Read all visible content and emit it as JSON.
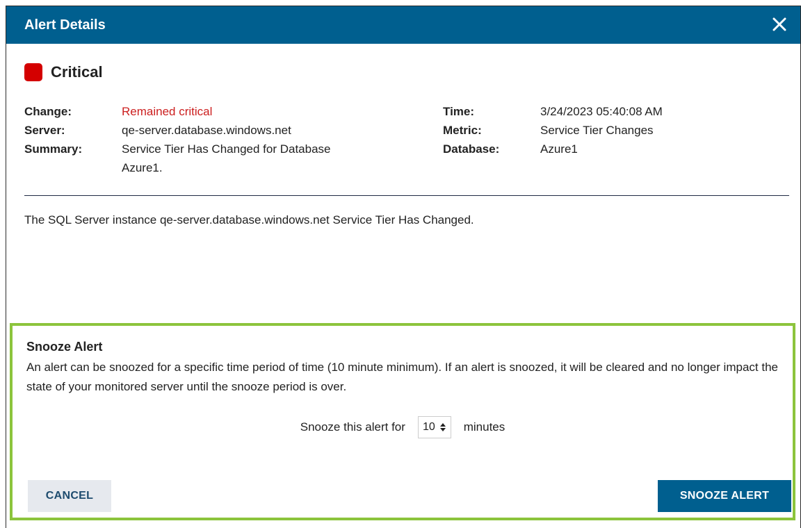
{
  "dialog": {
    "title": "Alert Details",
    "close_icon": "close-icon"
  },
  "severity": {
    "label": "Critical",
    "color": "#d40000"
  },
  "details": {
    "left": [
      {
        "key": "Change:",
        "value": "Remained critical"
      },
      {
        "key": "Server:",
        "value": "qe-server.database.windows.net"
      },
      {
        "key": "Summary:",
        "value": "Service Tier Has Changed for Database",
        "value2": "Azure1."
      }
    ],
    "right": [
      {
        "key": "Time:",
        "value": "3/24/2023 05:40:08 AM"
      },
      {
        "key": "Metric:",
        "value": "Service Tier Changes"
      },
      {
        "key": "Database:",
        "value": "Azure1"
      }
    ]
  },
  "message": "The SQL Server instance qe-server.database.windows.net Service Tier Has Changed.",
  "snooze": {
    "heading": "Snooze Alert",
    "description": "An alert can be snoozed for a specific time period of time (10 minute minimum). If an alert is snoozed, it will be cleared and no longer impact the state of your monitored server until the snooze period is over.",
    "prefix": "Snooze this alert for",
    "value": "10",
    "suffix": "minutes",
    "cancel_label": "CANCEL",
    "confirm_label": "SNOOZE ALERT"
  },
  "colors": {
    "header": "#005f8f",
    "highlight": "#8cc43c",
    "critical_text": "#cc1f1f"
  }
}
